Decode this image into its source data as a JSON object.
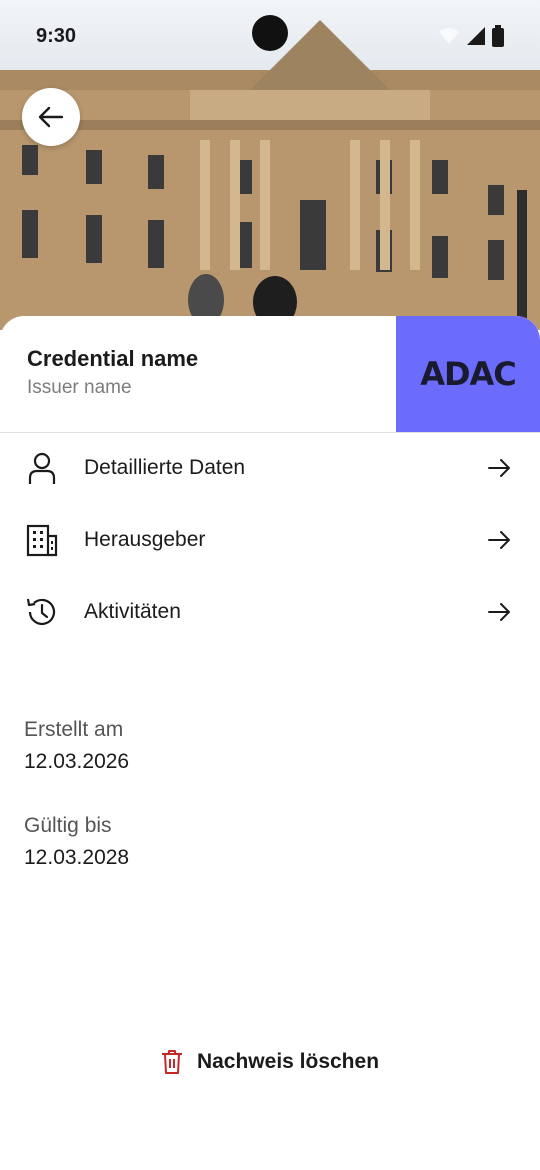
{
  "status_bar": {
    "time": "9:30"
  },
  "card": {
    "title": "Credential name",
    "subtitle": "Issuer name",
    "issuer_logo_text": "ADAC",
    "issuer_color": "#6b6cfb"
  },
  "menu": {
    "items": [
      {
        "label": "Detaillierte Daten",
        "icon": "person-icon"
      },
      {
        "label": "Herausgeber",
        "icon": "building-icon"
      },
      {
        "label": "Aktivitäten",
        "icon": "history-icon"
      }
    ]
  },
  "info": {
    "created_label": "Erstellt am",
    "created_value": "12.03.2026",
    "valid_label": "Gültig bis",
    "valid_value": "12.03.2028"
  },
  "actions": {
    "delete_label": "Nachweis löschen",
    "delete_color": "#c62828"
  }
}
